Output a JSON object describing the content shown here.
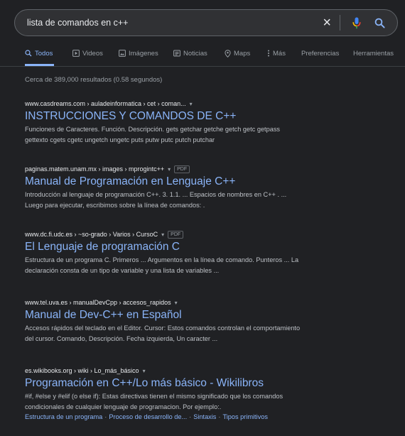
{
  "search": {
    "query": "lista de comandos en c++",
    "clear_glyph": "×"
  },
  "icons": {
    "mic": "microphone-icon",
    "search": "search-icon"
  },
  "colors": {
    "background": "#202124",
    "link": "#8ab4f8",
    "text": "#bdc1c6",
    "mic_red": "#ea4335",
    "mic_yellow": "#fbbc04",
    "mic_green": "#34a853",
    "mic_blue": "#4285f4"
  },
  "tabs": [
    {
      "label": "Todos",
      "active": true
    },
    {
      "label": "Videos"
    },
    {
      "label": "Imágenes"
    },
    {
      "label": "Noticias"
    },
    {
      "label": "Maps"
    },
    {
      "label": "Más"
    },
    {
      "label": "Preferencias"
    },
    {
      "label": "Herramientas"
    }
  ],
  "stats": "Cerca de 389,000 resultados (0.58 segundos)",
  "results": [
    {
      "url": "www.casdreams.com › auladeinformatica › cet › coman...",
      "title": "INSTRUCCIONES Y COMANDOS DE C++",
      "snippet_lines": [
        "Funciones de Caracteres. Función. Descripción. gets getchar getche getch getc getpass",
        "gettexto cgets cgetc ungetch ungetc puts putw putc putch putchar"
      ]
    },
    {
      "url": "paginas.matem.unam.mx › images › mprogintc++",
      "badge": "PDF",
      "title": "Manual de Programación en Lenguaje C++",
      "snippet_lines": [
        "Introducción al lenguaje de programación C++. 3. 1.1. ... Espacios de nombres en C++ . ...",
        "Luego para ejecutar, escribimos sobre la línea de comandos: ."
      ]
    },
    {
      "url": "www.dc.fi.udc.es › ~so-grado › Varios › CursoC",
      "badge": "PDF",
      "title": "El Lenguaje de programación C",
      "snippet_lines": [
        "Estructura de un programa C. Primeros ... Argumentos en la línea de comando. Punteros ... La",
        "declaración consta de un tipo de variable y una lista de variables ..."
      ]
    },
    {
      "url": "www.tel.uva.es › manualDevCpp › accesos_rapidos",
      "title": "Manual de Dev-C++ en Español",
      "snippet_lines": [
        "Accesos rápidos del teclado en el Editor. Cursor: Estos comandos controlan el comportamiento",
        "del cursor. Comando, Descripción. Fecha izquierda, Un caracter ..."
      ]
    },
    {
      "url": "es.wikibooks.org › wiki › Lo_más_básico",
      "title": "Programación en C++/Lo más básico - Wikilibros",
      "snippet_lines": [
        "#if, #else y #elif (o else if): Estas directivas tienen el mismo significado que los comandos",
        "condicionales de cualquier lenguaje de programacion. Por ejemplo:."
      ],
      "sitelinks": [
        "Estructura de un programa",
        "Proceso de desarrollo de...",
        "Sintaxis",
        "Tipos primitivos"
      ],
      "sitelink_sep": "·"
    }
  ]
}
